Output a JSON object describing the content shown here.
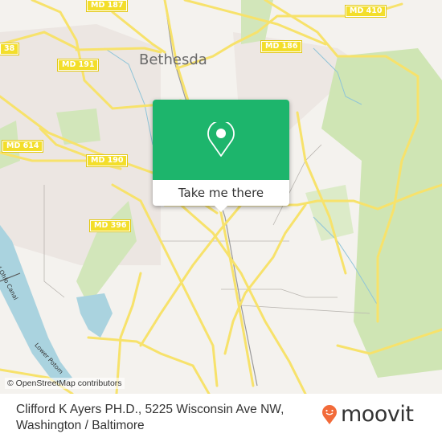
{
  "map": {
    "place_labels": [
      {
        "name": "Bethesda"
      }
    ],
    "road_shields": [
      {
        "label": "MD 187"
      },
      {
        "label": "MD 410"
      },
      {
        "label": "38"
      },
      {
        "label": "MD 191"
      },
      {
        "label": "MD 186"
      },
      {
        "label": "MD 614"
      },
      {
        "label": "MD 190"
      },
      {
        "label": "MD 396"
      }
    ],
    "water_labels": [
      {
        "label": "ke and Ohio Canal"
      },
      {
        "label": "Lower Potom"
      }
    ],
    "attribution": "© OpenStreetMap contributors",
    "colors": {
      "land": "#f2efe9",
      "park": "#cde6b0",
      "water": "#aad3df",
      "road": "#f7e26b"
    }
  },
  "popup": {
    "icon": "map-pin-icon",
    "action_label": "Take me there",
    "accent_color": "#1db56c"
  },
  "footer": {
    "address_line1": "Clifford K Ayers PH.D., 5225 Wisconsin Ave NW,",
    "address_line2": "Washington / Baltimore",
    "brand": "moovit",
    "brand_color": "#f26b3a"
  }
}
